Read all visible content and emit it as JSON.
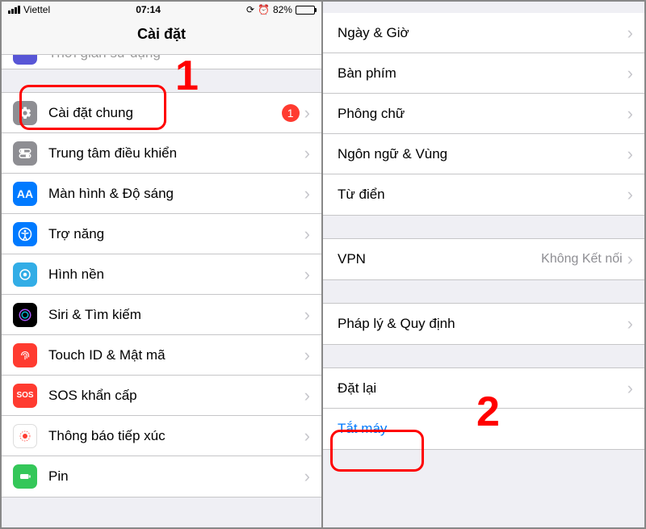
{
  "status": {
    "carrier": "Viettel",
    "time": "07:14",
    "battery_pct": "82%",
    "battery_fill_pct": 82
  },
  "left": {
    "title": "Cài đặt",
    "partial_row_label": "Thời gian sử dụng",
    "rows": {
      "general": {
        "label": "Cài đặt chung",
        "badge": "1"
      },
      "control": {
        "label": "Trung tâm điều khiển"
      },
      "display": {
        "label": "Màn hình & Độ sáng"
      },
      "accessibility": {
        "label": "Trợ năng"
      },
      "wallpaper": {
        "label": "Hình nền"
      },
      "siri": {
        "label": "Siri & Tìm kiếm"
      },
      "touchid": {
        "label": "Touch ID & Mật mã"
      },
      "sos": {
        "label": "SOS khẩn cấp",
        "icon_text": "SOS"
      },
      "exposure": {
        "label": "Thông báo tiếp xúc"
      },
      "battery": {
        "label": "Pin"
      }
    }
  },
  "right": {
    "rows": {
      "datetime": {
        "label": "Ngày & Giờ"
      },
      "keyboard": {
        "label": "Bàn phím"
      },
      "fonts": {
        "label": "Phông chữ"
      },
      "language": {
        "label": "Ngôn ngữ & Vùng"
      },
      "dictionary": {
        "label": "Từ điển"
      },
      "vpn": {
        "label": "VPN",
        "detail": "Không Kết nối"
      },
      "legal": {
        "label": "Pháp lý & Quy định"
      },
      "reset": {
        "label": "Đặt lại"
      },
      "shutdown": {
        "label": "Tắt máy"
      }
    }
  },
  "annotations": {
    "step1": "1",
    "step2": "2"
  }
}
